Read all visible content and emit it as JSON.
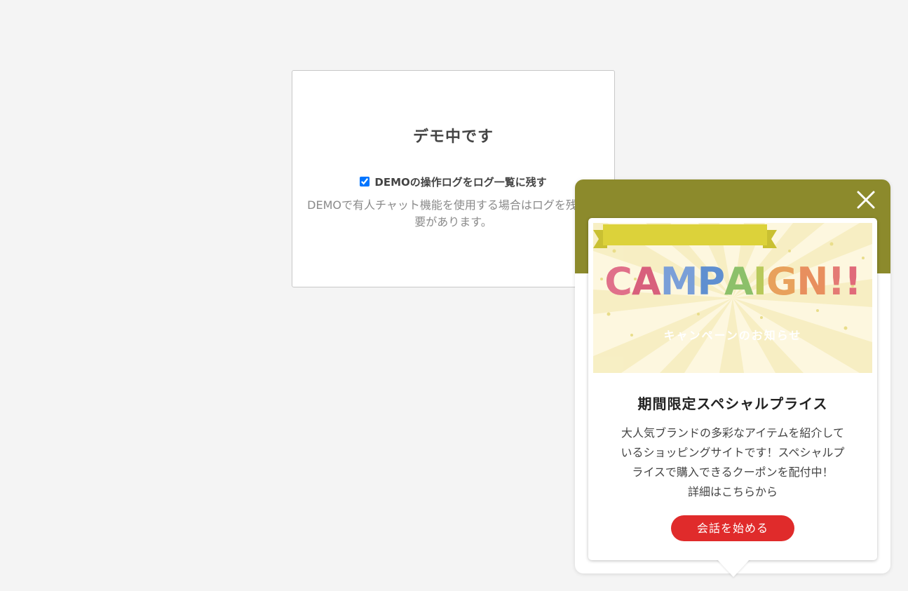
{
  "demo": {
    "title": "デモ中です",
    "checkbox_label": "DEMOの操作ログをログ一覧に残す",
    "checkbox_checked": true,
    "description": "DEMOで有人チャット機能を使用する場合はログを残す必要があります。"
  },
  "widget": {
    "header_color": "#8c8a2c",
    "close_icon": "close-icon",
    "banner": {
      "headline_letters": [
        "C",
        "A",
        "M",
        "P",
        "A",
        "I",
        "G",
        "N",
        "!",
        "!"
      ],
      "headline_colors": [
        "#e0708a",
        "#d8607c",
        "#7a9fd8",
        "#5f8fd0",
        "#8cc06a",
        "#b8c95a",
        "#e8a15c",
        "#e88f5e",
        "#e47a74",
        "#e06a7a"
      ],
      "ribbon_text": "キャンペーンのお知らせ",
      "ribbon_color": "#dcd23a"
    },
    "title": "期間限定スペシャルプライス",
    "description": "大人気ブランドの多彩なアイテムを紹介して\nいるショッピングサイトです！スペシャルプ\nライスで購入できるクーポンを配付中！\n詳細はこちらから",
    "start_button": "会話を始める",
    "accent_color": "#e02b2b"
  }
}
